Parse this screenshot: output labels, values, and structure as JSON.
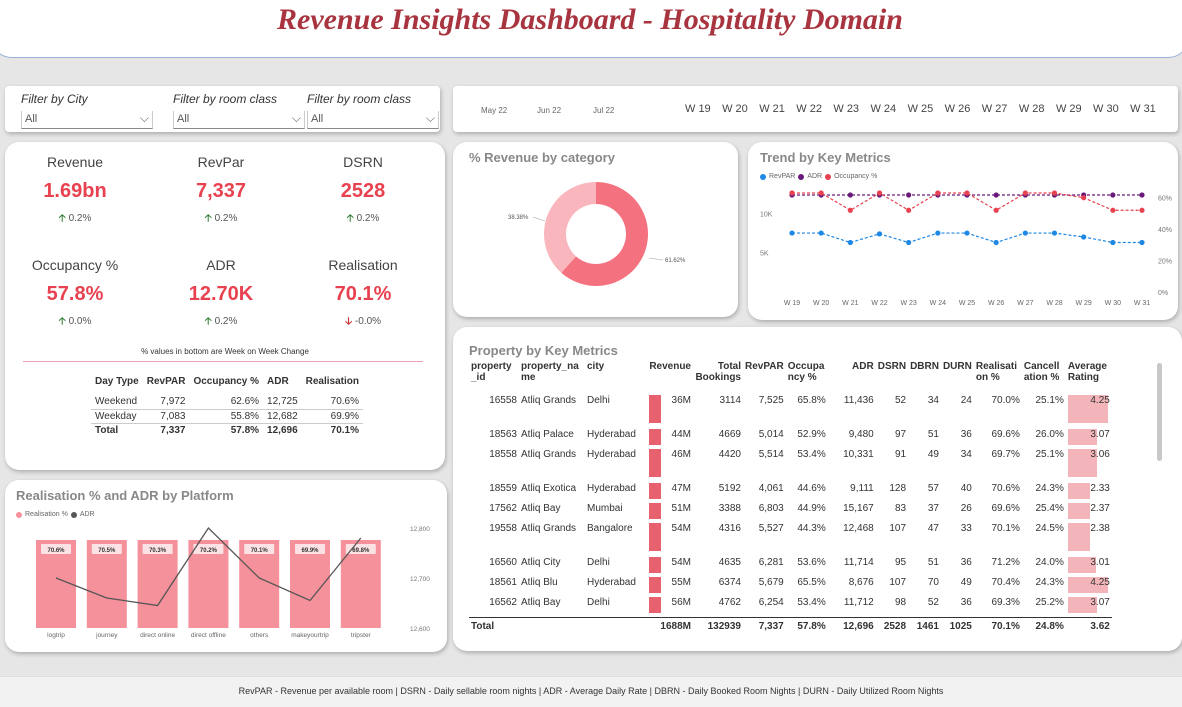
{
  "header": {
    "title": "Revenue Insights Dashboard - Hospitality Domain"
  },
  "filters": [
    {
      "label": "Filter by City",
      "value": "All"
    },
    {
      "label": "Filter by room class",
      "value": "All"
    },
    {
      "label": "Filter by room class",
      "value": "All"
    }
  ],
  "months": [
    "May 22",
    "Jun 22",
    "Jul 22"
  ],
  "weeks": [
    "W 19",
    "W 20",
    "W 21",
    "W 22",
    "W 23",
    "W 24",
    "W 25",
    "W 26",
    "W 27",
    "W 28",
    "W 29",
    "W 30",
    "W 31"
  ],
  "kpis": [
    {
      "name": "Revenue",
      "value": "1.69bn",
      "change": "0.2%",
      "dir": "up"
    },
    {
      "name": "RevPar",
      "value": "7,337",
      "change": "0.2%",
      "dir": "up"
    },
    {
      "name": "DSRN",
      "value": "2528",
      "change": "0.2%",
      "dir": "up"
    },
    {
      "name": "Occupancy %",
      "value": "57.8%",
      "change": "0.0%",
      "dir": "up"
    },
    {
      "name": "ADR",
      "value": "12.70K",
      "change": "0.2%",
      "dir": "up"
    },
    {
      "name": "Realisation",
      "value": "70.1%",
      "change": "-0.0%",
      "dir": "down"
    }
  ],
  "kpi_note": "% values in bottom are Week on Week Change",
  "daytype_table": {
    "headers": [
      "Day Type",
      "RevPAR",
      "Occupancy %",
      "ADR",
      "Realisation"
    ],
    "rows": [
      [
        "Weekend",
        "7,972",
        "62.6%",
        "12,725",
        "70.6%"
      ],
      [
        "Weekday",
        "7,083",
        "55.8%",
        "12,682",
        "69.9%"
      ]
    ],
    "total": [
      "Total",
      "7,337",
      "57.8%",
      "12,696",
      "70.1%"
    ]
  },
  "donut": {
    "title": "% Revenue by category",
    "labels": [
      "38.38%",
      "61.62%"
    ]
  },
  "trend": {
    "title": "Trend by Key Metrics",
    "legend": [
      "RevPAR",
      "ADR",
      "Occupancy %"
    ],
    "y_left": [
      "10K",
      "5K"
    ],
    "y_right": [
      "60%",
      "40%",
      "20%",
      "0%"
    ]
  },
  "platform": {
    "title": "Realisation % and ADR by Platform",
    "legend": [
      "Realisation %",
      "ADR"
    ],
    "y_right": [
      "12,800",
      "12,700",
      "12,600"
    ]
  },
  "property": {
    "title": "Property by Key Metrics",
    "headers": [
      "property\n_id",
      "property_na\nme",
      "city",
      "Revenue",
      "Total\nBookings",
      "RevPAR",
      "Occupa\nncy %",
      "ADR",
      "DSRN",
      "DBRN",
      "DURN",
      "Realisati\non %",
      "Cancell\nation %",
      "Average\nRating"
    ],
    "rows": [
      [
        "16558",
        "Atliq Grands",
        "Delhi",
        "36M",
        "3114",
        "7,525",
        "65.8%",
        "11,436",
        "52",
        "34",
        "24",
        "70.0%",
        "25.1%",
        "4.25"
      ],
      [
        "18563",
        "Atliq Palace",
        "Hyderabad",
        "44M",
        "4669",
        "5,014",
        "52.9%",
        "9,480",
        "97",
        "51",
        "36",
        "69.6%",
        "26.0%",
        "3.07"
      ],
      [
        "18558",
        "Atliq Grands",
        "Hyderabad",
        "46M",
        "4420",
        "5,514",
        "53.4%",
        "10,331",
        "91",
        "49",
        "34",
        "69.7%",
        "25.1%",
        "3.06"
      ],
      [
        "18559",
        "Atliq Exotica",
        "Hyderabad",
        "47M",
        "5192",
        "4,061",
        "44.6%",
        "9,111",
        "128",
        "57",
        "40",
        "70.6%",
        "24.3%",
        "2.33"
      ],
      [
        "17562",
        "Atliq Bay",
        "Mumbai",
        "51M",
        "3388",
        "6,803",
        "44.9%",
        "15,167",
        "83",
        "37",
        "26",
        "69.6%",
        "25.4%",
        "2.37"
      ],
      [
        "19558",
        "Atliq Grands",
        "Bangalore",
        "54M",
        "4316",
        "5,527",
        "44.3%",
        "12,468",
        "107",
        "47",
        "33",
        "70.1%",
        "24.5%",
        "2.38"
      ],
      [
        "16560",
        "Atliq City",
        "Delhi",
        "54M",
        "4635",
        "6,281",
        "53.6%",
        "11,714",
        "95",
        "51",
        "36",
        "71.2%",
        "24.0%",
        "3.01"
      ],
      [
        "18561",
        "Atliq Blu",
        "Hyderabad",
        "55M",
        "6374",
        "5,679",
        "65.5%",
        "8,676",
        "107",
        "70",
        "49",
        "70.4%",
        "24.3%",
        "4.25"
      ],
      [
        "16562",
        "Atliq Bay",
        "Delhi",
        "56M",
        "4762",
        "6,254",
        "53.4%",
        "11,712",
        "98",
        "52",
        "36",
        "69.3%",
        "25.2%",
        "3.07"
      ]
    ],
    "total": [
      "Total",
      "",
      "",
      "1688M",
      "132939",
      "7,337",
      "57.8%",
      "12,696",
      "2528",
      "1461",
      "1025",
      "70.1%",
      "24.8%",
      "3.62"
    ]
  },
  "footer": "RevPAR - Revenue per available room | DSRN - Daily sellable room nights | ADR - Average Daily Rate | DBRN - Daily Booked Room Nights | DURN - Daily Utilized Room Nights",
  "colors": {
    "accent": "#e8414f",
    "title": "#a8343f",
    "bar": "#f4919a",
    "donut_main": "#f4727f",
    "donut_minor": "#f9b6bd",
    "revpar": "#1e88e5",
    "adr": "#6a1b7a",
    "occupancy": "#e8414f"
  },
  "chart_data": [
    {
      "type": "pie",
      "title": "% Revenue by category",
      "categories": [
        "",
        ""
      ],
      "values": [
        61.62,
        38.38
      ]
    },
    {
      "type": "line",
      "title": "Trend by Key Metrics",
      "x": [
        "W 19",
        "W 20",
        "W 21",
        "W 22",
        "W 23",
        "W 24",
        "W 25",
        "W 26",
        "W 27",
        "W 28",
        "W 29",
        "W 30",
        "W 31"
      ],
      "series": [
        {
          "name": "RevPAR",
          "values": [
            7500,
            7500,
            6300,
            7400,
            6300,
            7500,
            7500,
            6300,
            7500,
            7500,
            7000,
            6300,
            6300
          ]
        },
        {
          "name": "ADR",
          "values": [
            12700,
            12700,
            12700,
            12700,
            12700,
            12700,
            12700,
            12700,
            12700,
            12700,
            12700,
            12700,
            12700
          ]
        },
        {
          "name": "Occupancy %",
          "values": [
            63,
            63,
            52,
            63,
            52,
            63,
            63,
            52,
            63,
            63,
            60,
            52,
            52
          ]
        }
      ],
      "ylim": [
        0,
        14000
      ],
      "y2lim": [
        0,
        70
      ]
    },
    {
      "type": "bar",
      "title": "Realisation % and ADR by Platform",
      "categories": [
        "logtrip",
        "journey",
        "direct online",
        "direct offline",
        "others",
        "makeyourtrip",
        "tripster"
      ],
      "series": [
        {
          "name": "Realisation %",
          "values": [
            70.6,
            70.5,
            70.3,
            70.2,
            70.1,
            69.9,
            69.8
          ],
          "labels": [
            "70.6%",
            "70.5%",
            "70.3%",
            "70.2%",
            "70.1%",
            "69.9%",
            "69.8%"
          ]
        },
        {
          "name": "ADR",
          "values": [
            12700,
            12660,
            12645,
            12800,
            12700,
            12655,
            12780
          ]
        }
      ],
      "y2lim": [
        12600,
        12800
      ]
    }
  ]
}
